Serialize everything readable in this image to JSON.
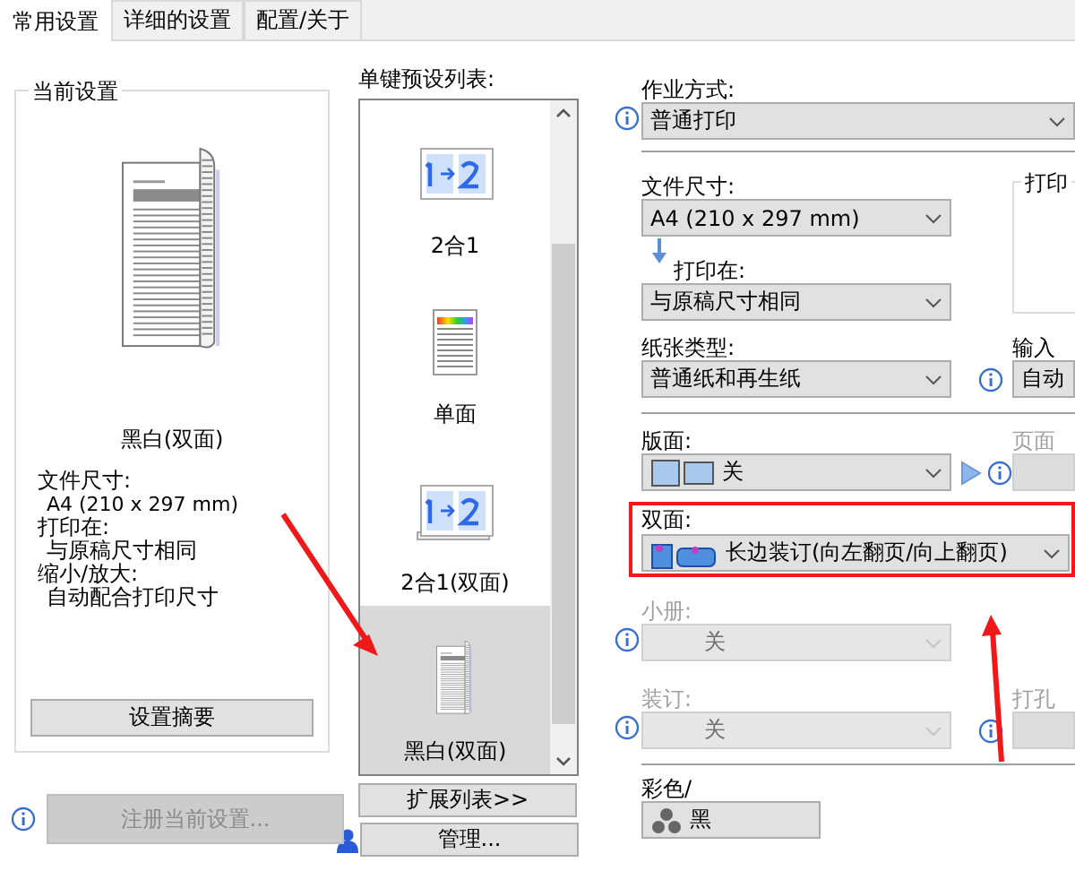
{
  "tabs": [
    {
      "label": "常用设置",
      "selected": true
    },
    {
      "label": "详细的设置",
      "selected": false
    },
    {
      "label": "配置/关于",
      "selected": false
    }
  ],
  "current_settings": {
    "title": "当前设置",
    "caption": "黑白(双面)",
    "details": [
      {
        "label": "文件尺寸:",
        "value": "A4 (210 x 297 mm)"
      },
      {
        "label": "打印在:",
        "value": "与原稿尺寸相同"
      },
      {
        "label": "缩小/放大:",
        "value": "自动配合打印尺寸"
      }
    ],
    "summary_button": "设置摘要"
  },
  "register_button": {
    "label": "注册当前设置...",
    "disabled": true
  },
  "presets": {
    "title": "单键预设列表:",
    "items": [
      {
        "label": "2合1",
        "kind": "two-in-one",
        "selected": false
      },
      {
        "label": "单面",
        "kind": "single",
        "selected": false
      },
      {
        "label": "2合1(双面)",
        "kind": "two-in-one-duplex",
        "selected": false
      },
      {
        "label": "黑白(双面)",
        "kind": "mono-duplex",
        "selected": true
      }
    ],
    "expand_button": "扩展列表>>",
    "manage_button": "管理..."
  },
  "settings": {
    "job_type": {
      "label": "作业方式:",
      "value": "普通打印"
    },
    "document_size": {
      "label": "文件尺寸:",
      "value": "A4 (210 x 297 mm)"
    },
    "print_on": {
      "label": "打印在:",
      "value": "与原稿尺寸相同"
    },
    "print_group": {
      "label": "打印"
    },
    "paper_type": {
      "label": "纸张类型:",
      "value": "普通纸和再生纸"
    },
    "input": {
      "label": "输入",
      "value": "自动"
    },
    "layout": {
      "label": "版面:",
      "value": "关"
    },
    "page": {
      "label": "页面",
      "disabled": true
    },
    "duplex": {
      "label": "双面:",
      "value": "长边装订(向左翻页/向上翻页)"
    },
    "booklet": {
      "label": "小册:",
      "value": "关",
      "disabled": true
    },
    "binding": {
      "label": "装订:",
      "value": "关",
      "disabled": true
    },
    "punch": {
      "label": "打孔",
      "disabled": true
    },
    "color": {
      "label": "彩色/",
      "value": "黑"
    }
  }
}
